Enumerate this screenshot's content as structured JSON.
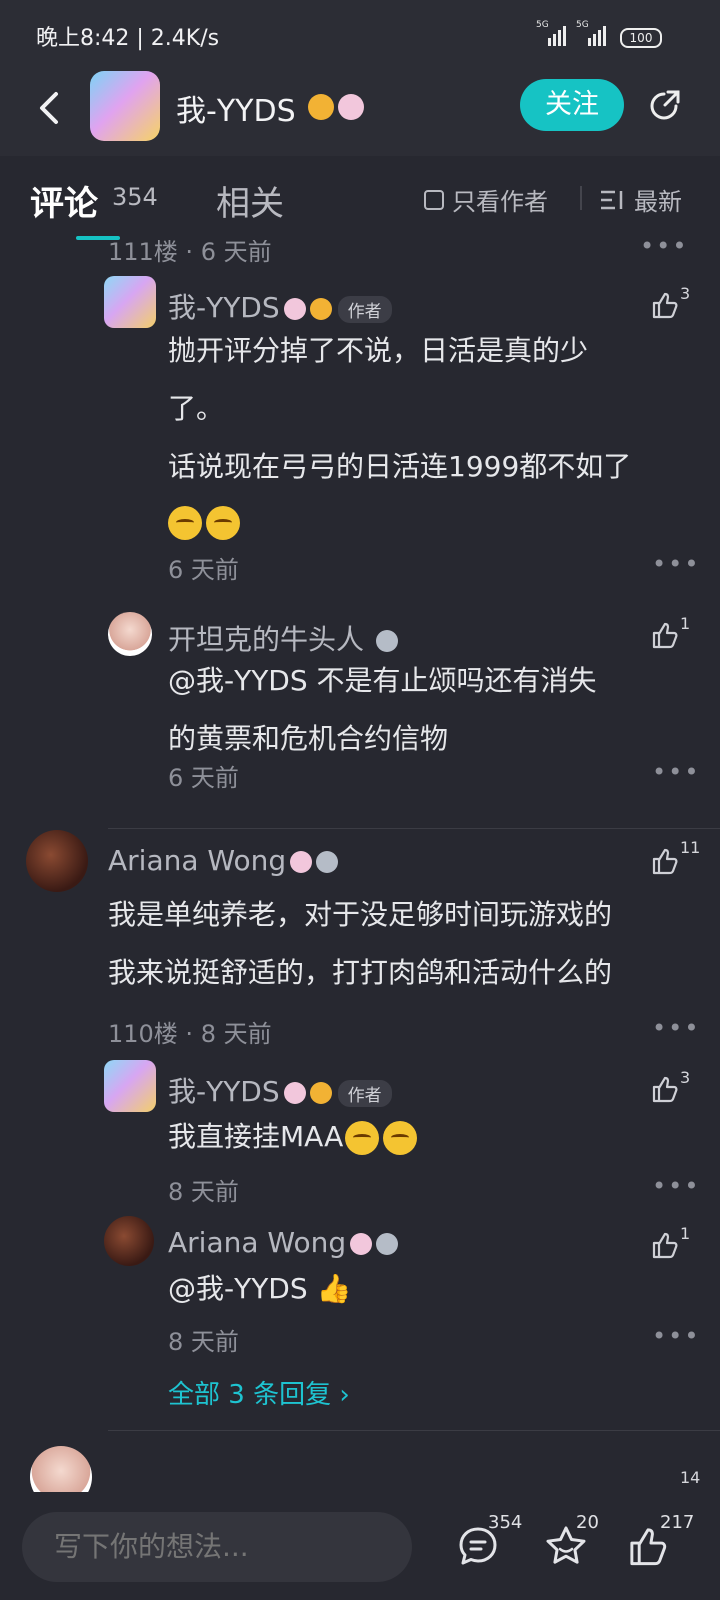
{
  "status_bar": {
    "time": "晚上8:42 | 2.4K/s",
    "network_1": "5G",
    "network_2": "5G",
    "battery": "100"
  },
  "header": {
    "user_name": "我-YYDS",
    "follow_label": "关注"
  },
  "tabs": {
    "comments_label": "评论",
    "comments_count": "354",
    "related_label": "相关",
    "only_author_label": "只看作者",
    "sort_label": "最新"
  },
  "thread_top": {
    "floor_meta": "111楼 · 6 天前",
    "replies": [
      {
        "user": "我-YYDS",
        "author_tag": "作者",
        "likes": "3",
        "lines": [
          "抛开评分掉了不说，日活是真的少",
          "了。",
          "话说现在弓弓的日活连1999都不如了"
        ],
        "time": "6 天前"
      },
      {
        "user": "开坦克的牛头人",
        "likes": "1",
        "lines": [
          "@我-YYDS  不是有止颂吗还有消失",
          "的黄票和危机合约信物"
        ],
        "time": "6 天前"
      }
    ]
  },
  "comment_110": {
    "user": "Ariana Wong",
    "likes": "11",
    "lines": [
      "我是单纯养老，对于没足够时间玩游戏的",
      "我来说挺舒适的，打打肉鸽和活动什么的"
    ],
    "floor_meta": "110楼 · 8 天前",
    "replies": [
      {
        "user": "我-YYDS",
        "author_tag": "作者",
        "likes": "3",
        "text": "我直接挂MAA",
        "time": "8 天前"
      },
      {
        "user": "Ariana Wong",
        "likes": "1",
        "text": "@我-YYDS  👍",
        "time": "8 天前"
      }
    ],
    "view_all": "全部 3 条回复 ›"
  },
  "next_comment": {
    "likes": "14"
  },
  "bottom_bar": {
    "input_placeholder": "写下你的想法...",
    "comment_count": "354",
    "favorite_count": "20",
    "like_count": "217"
  },
  "more_glyph": "•••"
}
